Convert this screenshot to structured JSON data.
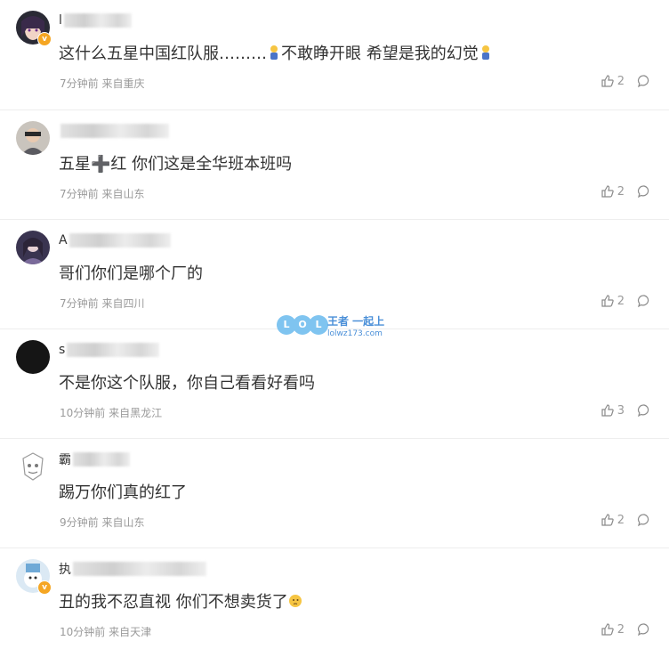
{
  "comments": [
    {
      "username_initial": "l",
      "text": "这什么五星中国红队服………",
      "text_after_emoji": "不敢睁开眼 希望是我的幻觉",
      "time": "7分钟前",
      "location": "来自重庆",
      "likes": "2"
    },
    {
      "username_initial": "",
      "text": "五星➕红 你们这是全华班本班吗",
      "time": "7分钟前",
      "location": "来自山东",
      "likes": "2"
    },
    {
      "username_initial": "A",
      "text": "哥们你们是哪个厂的",
      "time": "7分钟前",
      "location": "来自四川",
      "likes": "2"
    },
    {
      "username_initial": "s",
      "text": "不是你这个队服，你自己看看好看吗",
      "time": "10分钟前",
      "location": "来自黑龙江",
      "likes": "3"
    },
    {
      "username_initial": "霸",
      "text": "踢万你们真的红了",
      "time": "9分钟前",
      "location": "来自山东",
      "likes": "2"
    },
    {
      "username_initial": "执",
      "text": "丑的我不忍直视 你们不想卖货了",
      "time": "10分钟前",
      "location": "来自天津",
      "likes": "2"
    }
  ],
  "watermark": {
    "letters": [
      "L",
      "O",
      "L"
    ],
    "title": "王者 一起上",
    "subtitle": "lolwz173.com"
  },
  "colors": {
    "text": "#333333",
    "meta": "#9a9a9a",
    "divider": "#eeeeee",
    "badge": "#f5a623",
    "watermark": "#4a8fd8"
  }
}
